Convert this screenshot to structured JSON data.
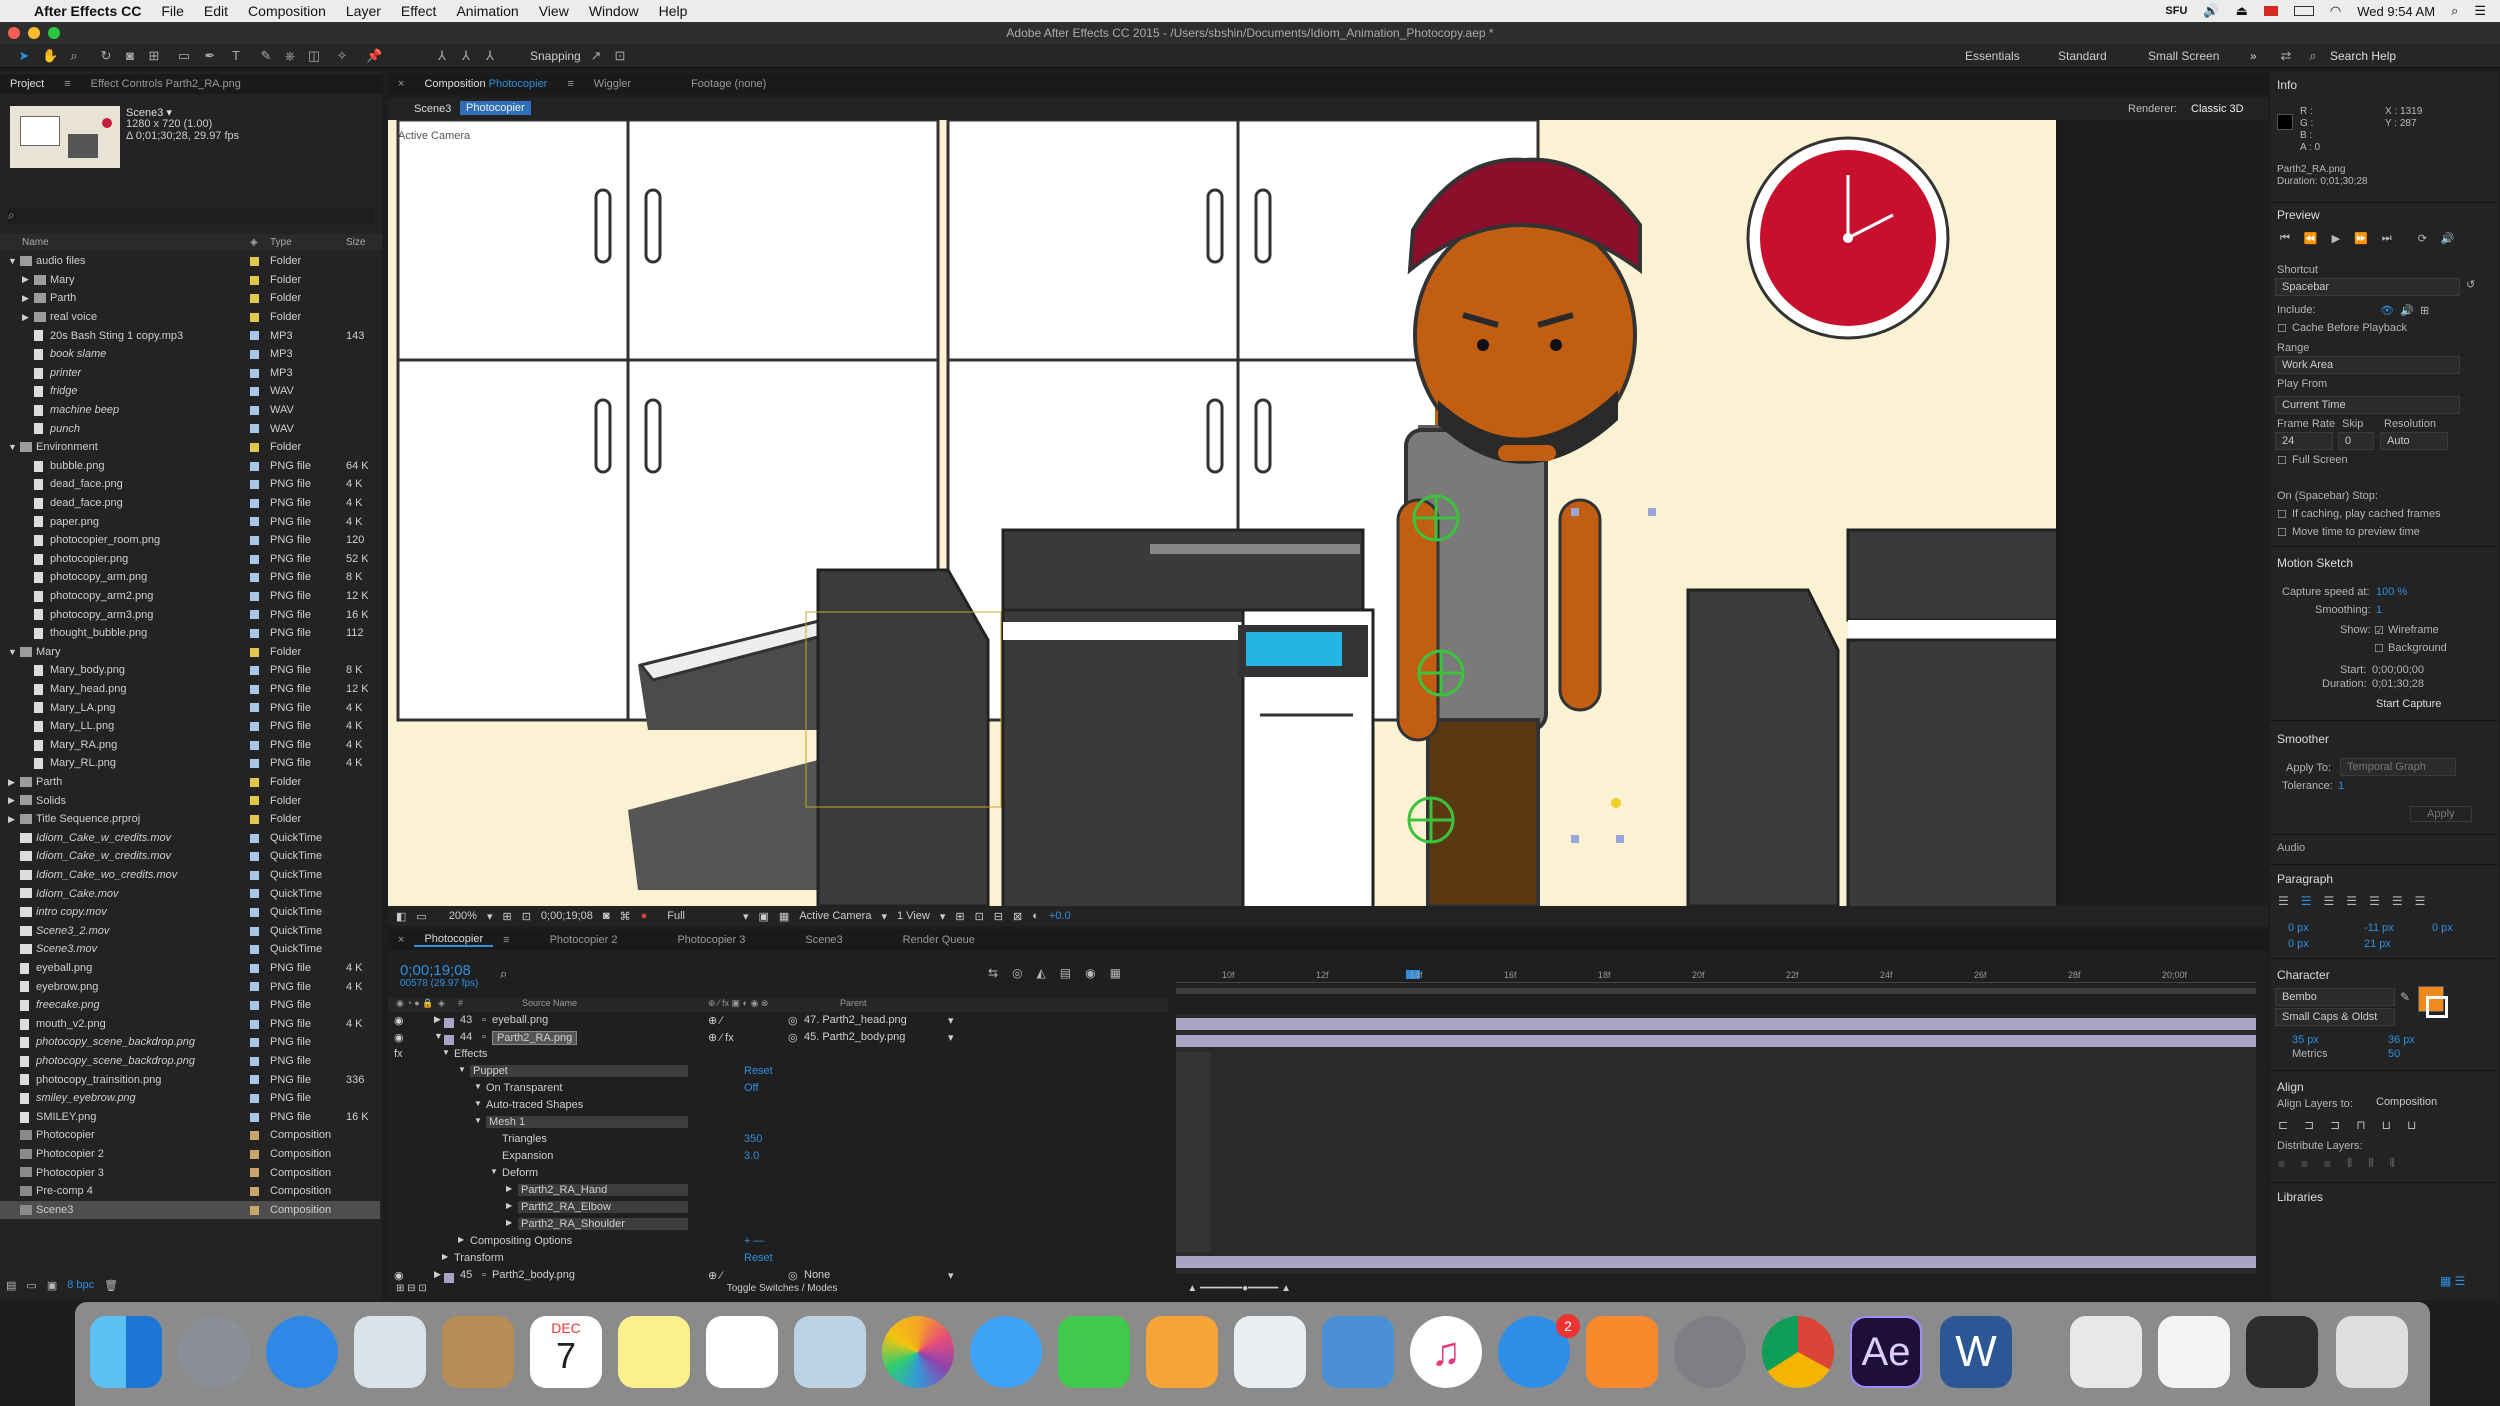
{
  "menubar": {
    "app_name": "After Effects CC",
    "items": [
      "File",
      "Edit",
      "Composition",
      "Layer",
      "Effect",
      "Animation",
      "View",
      "Window",
      "Help"
    ],
    "status": {
      "user": "SFU",
      "datetime": "Wed 9:54 AM"
    }
  },
  "window": {
    "title": "Adobe After Effects CC 2015 - /Users/sbshin/Documents/Idiom_Animation_Photocopy.aep *"
  },
  "toolbar": {
    "snapping_label": "Snapping",
    "workspaces": [
      "Essentials",
      "Standard",
      "Small Screen"
    ],
    "search_placeholder": "Search Help"
  },
  "project_panel": {
    "tab_project": "Project",
    "tab_effect_controls": "Effect Controls Parth2_RA.png",
    "selected_name": "Scene3 ▾",
    "selected_info": [
      "1280 x 720 (1.00)",
      "Δ 0;01;30;28, 29.97 fps"
    ],
    "columns": {
      "name": "Name",
      "type": "Type",
      "size": "Size"
    },
    "footer_bpc": "8 bpc",
    "items": [
      {
        "indent": 0,
        "kind": "folder",
        "open": true,
        "name": "audio files",
        "type": "Folder",
        "size": "",
        "color": "#e3c74c"
      },
      {
        "indent": 1,
        "kind": "folder",
        "name": "Mary",
        "type": "Folder",
        "size": "",
        "color": "#e3c74c"
      },
      {
        "indent": 1,
        "kind": "folder",
        "name": "Parth",
        "type": "Folder",
        "size": "",
        "color": "#e3c74c"
      },
      {
        "indent": 1,
        "kind": "folder",
        "name": "real voice",
        "type": "Folder",
        "size": "",
        "color": "#e3c74c"
      },
      {
        "indent": 1,
        "kind": "file",
        "name": "20s Bash Sting 1 copy.mp3",
        "type": "MP3",
        "size": "143",
        "color": "#a7c8e8"
      },
      {
        "indent": 1,
        "kind": "file",
        "name": "book slame",
        "italic": true,
        "type": "MP3",
        "size": "",
        "color": "#a7c8e8"
      },
      {
        "indent": 1,
        "kind": "file",
        "name": "printer",
        "italic": true,
        "type": "MP3",
        "size": "",
        "color": "#a7c8e8"
      },
      {
        "indent": 1,
        "kind": "file",
        "name": "fridge",
        "italic": true,
        "type": "WAV",
        "size": "",
        "color": "#a7c8e8"
      },
      {
        "indent": 1,
        "kind": "file",
        "name": "machine beep",
        "italic": true,
        "type": "WAV",
        "size": "",
        "color": "#a7c8e8"
      },
      {
        "indent": 1,
        "kind": "file",
        "name": "punch",
        "italic": true,
        "type": "WAV",
        "size": "",
        "color": "#a7c8e8"
      },
      {
        "indent": 0,
        "kind": "folder",
        "open": true,
        "name": "Environment",
        "type": "Folder",
        "size": "",
        "color": "#e3c74c"
      },
      {
        "indent": 1,
        "kind": "file",
        "name": "bubble.png",
        "type": "PNG file",
        "size": "64 K",
        "color": "#a7c8e8"
      },
      {
        "indent": 1,
        "kind": "file",
        "name": "dead_face.png",
        "type": "PNG file",
        "size": "4 K",
        "color": "#a7c8e8"
      },
      {
        "indent": 1,
        "kind": "file",
        "name": "dead_face.png",
        "type": "PNG file",
        "size": "4 K",
        "color": "#a7c8e8"
      },
      {
        "indent": 1,
        "kind": "file",
        "name": "paper.png",
        "type": "PNG file",
        "size": "4 K",
        "color": "#a7c8e8"
      },
      {
        "indent": 1,
        "kind": "file",
        "name": "photocopier_room.png",
        "type": "PNG file",
        "size": "120",
        "color": "#a7c8e8"
      },
      {
        "indent": 1,
        "kind": "file",
        "name": "photocopier.png",
        "type": "PNG file",
        "size": "52 K",
        "color": "#a7c8e8"
      },
      {
        "indent": 1,
        "kind": "file",
        "name": "photocopy_arm.png",
        "type": "PNG file",
        "size": "8 K",
        "color": "#a7c8e8"
      },
      {
        "indent": 1,
        "kind": "file",
        "name": "photocopy_arm2.png",
        "type": "PNG file",
        "size": "12 K",
        "color": "#a7c8e8"
      },
      {
        "indent": 1,
        "kind": "file",
        "name": "photocopy_arm3.png",
        "type": "PNG file",
        "size": "16 K",
        "color": "#a7c8e8"
      },
      {
        "indent": 1,
        "kind": "file",
        "name": "thought_bubble.png",
        "type": "PNG file",
        "size": "112",
        "color": "#a7c8e8"
      },
      {
        "indent": 0,
        "kind": "folder",
        "open": true,
        "name": "Mary",
        "type": "Folder",
        "size": "",
        "color": "#e3c74c"
      },
      {
        "indent": 1,
        "kind": "file",
        "name": "Mary_body.png",
        "type": "PNG file",
        "size": "8 K",
        "color": "#a7c8e8"
      },
      {
        "indent": 1,
        "kind": "file",
        "name": "Mary_head.png",
        "type": "PNG file",
        "size": "12 K",
        "color": "#a7c8e8"
      },
      {
        "indent": 1,
        "kind": "file",
        "name": "Mary_LA.png",
        "type": "PNG file",
        "size": "4 K",
        "color": "#a7c8e8"
      },
      {
        "indent": 1,
        "kind": "file",
        "name": "Mary_LL.png",
        "type": "PNG file",
        "size": "4 K",
        "color": "#a7c8e8"
      },
      {
        "indent": 1,
        "kind": "file",
        "name": "Mary_RA.png",
        "type": "PNG file",
        "size": "4 K",
        "color": "#a7c8e8"
      },
      {
        "indent": 1,
        "kind": "file",
        "name": "Mary_RL.png",
        "type": "PNG file",
        "size": "4 K",
        "color": "#a7c8e8"
      },
      {
        "indent": 0,
        "kind": "folder",
        "name": "Parth",
        "type": "Folder",
        "size": "",
        "color": "#e3c74c"
      },
      {
        "indent": 0,
        "kind": "folder",
        "name": "Solids",
        "type": "Folder",
        "size": "",
        "color": "#e3c74c"
      },
      {
        "indent": 0,
        "kind": "folder",
        "name": "Title Sequence.prproj",
        "type": "Folder",
        "size": "",
        "color": "#e3c74c"
      },
      {
        "indent": 0,
        "kind": "movie",
        "name": "Idiom_Cake_w_credits.mov",
        "italic": true,
        "type": "QuickTime",
        "size": "",
        "color": "#a7c8e8"
      },
      {
        "indent": 0,
        "kind": "movie",
        "name": "Idiom_Cake_w_credits.mov",
        "italic": true,
        "type": "QuickTime",
        "size": "",
        "color": "#a7c8e8"
      },
      {
        "indent": 0,
        "kind": "movie",
        "name": "Idiom_Cake_wo_credits.mov",
        "italic": true,
        "type": "QuickTime",
        "size": "",
        "color": "#a7c8e8"
      },
      {
        "indent": 0,
        "kind": "movie",
        "name": "Idiom_Cake.mov",
        "italic": true,
        "type": "QuickTime",
        "size": "",
        "color": "#a7c8e8"
      },
      {
        "indent": 0,
        "kind": "movie",
        "name": "intro copy.mov",
        "italic": true,
        "type": "QuickTime",
        "size": "",
        "color": "#a7c8e8"
      },
      {
        "indent": 0,
        "kind": "movie",
        "name": "Scene3_2.mov",
        "italic": true,
        "type": "QuickTime",
        "size": "",
        "color": "#a7c8e8"
      },
      {
        "indent": 0,
        "kind": "movie",
        "name": "Scene3.mov",
        "italic": true,
        "type": "QuickTime",
        "size": "",
        "color": "#a7c8e8"
      },
      {
        "indent": 0,
        "kind": "file",
        "name": "eyeball.png",
        "type": "PNG file",
        "size": "4 K",
        "color": "#a7c8e8"
      },
      {
        "indent": 0,
        "kind": "file",
        "name": "eyebrow.png",
        "type": "PNG file",
        "size": "4 K",
        "color": "#a7c8e8"
      },
      {
        "indent": 0,
        "kind": "file",
        "name": "freecake.png",
        "italic": true,
        "type": "PNG file",
        "size": "",
        "color": "#a7c8e8"
      },
      {
        "indent": 0,
        "kind": "file",
        "name": "mouth_v2.png",
        "type": "PNG file",
        "size": "4 K",
        "color": "#a7c8e8"
      },
      {
        "indent": 0,
        "kind": "file",
        "name": "photocopy_scene_backdrop.png",
        "italic": true,
        "type": "PNG file",
        "size": "",
        "color": "#a7c8e8"
      },
      {
        "indent": 0,
        "kind": "file",
        "name": "photocopy_scene_backdrop.png",
        "italic": true,
        "type": "PNG file",
        "size": "",
        "color": "#a7c8e8"
      },
      {
        "indent": 0,
        "kind": "file",
        "name": "photocopy_trainsition.png",
        "type": "PNG file",
        "size": "336",
        "color": "#a7c8e8"
      },
      {
        "indent": 0,
        "kind": "file",
        "name": "smiley_eyebrow.png",
        "italic": true,
        "type": "PNG file",
        "size": "",
        "color": "#a7c8e8"
      },
      {
        "indent": 0,
        "kind": "file",
        "name": "SMILEY.png",
        "type": "PNG file",
        "size": "16 K",
        "color": "#a7c8e8"
      },
      {
        "indent": 0,
        "kind": "comp",
        "name": "Photocopier",
        "type": "Composition",
        "size": "",
        "color": "#c9a46b"
      },
      {
        "indent": 0,
        "kind": "comp",
        "name": "Photocopier 2",
        "type": "Composition",
        "size": "",
        "color": "#c9a46b"
      },
      {
        "indent": 0,
        "kind": "comp",
        "name": "Photocopier 3",
        "type": "Composition",
        "size": "",
        "color": "#c9a46b"
      },
      {
        "indent": 0,
        "kind": "comp",
        "name": "Pre-comp 4",
        "type": "Composition",
        "size": "",
        "color": "#c9a46b"
      },
      {
        "indent": 0,
        "kind": "comp",
        "name": "Scene3",
        "type": "Composition",
        "size": "",
        "color": "#c9a46b",
        "selected": true
      }
    ]
  },
  "comp_panel": {
    "tab_prefix": "Composition",
    "tab_name": "Photocopier",
    "other_tabs": [
      "Wiggler",
      "Footage (none)"
    ],
    "breadcrumbs": [
      "Scene3",
      "Photocopier"
    ],
    "renderer_label": "Renderer:",
    "renderer_value": "Classic 3D",
    "camera_label": "Active Camera",
    "footer": {
      "zoom": "200%",
      "timecode": "0;00;19;08",
      "resolution": "Full",
      "view": "Active Camera",
      "views": "1 View",
      "exposure": "+0.0"
    }
  },
  "timeline": {
    "tabs": [
      "Photocopier",
      "Photocopier 2",
      "Photocopier 3",
      "Scene3",
      "Render Queue"
    ],
    "current_time": "0;00;19;08",
    "frame_info": "00578 (29.97 fps)",
    "columns": {
      "num": "#",
      "source": "Source Name",
      "parent": "Parent"
    },
    "ruler": [
      "10f",
      "12f",
      "14f",
      "16f",
      "18f",
      "20f",
      "22f",
      "24f",
      "26f",
      "28f",
      "20;00f"
    ],
    "layers": [
      {
        "num": "43",
        "name": "eyeball.png",
        "parent": "47. Parth2_head.png"
      },
      {
        "num": "44",
        "name": "Parth2_RA.png",
        "parent": "45. Parth2_body.png",
        "selected": true
      }
    ],
    "props": [
      {
        "indent": 1,
        "label": "Effects",
        "value": ""
      },
      {
        "indent": 2,
        "label": "Puppet",
        "value": "Reset",
        "highlight": true
      },
      {
        "indent": 3,
        "label": "On Transparent",
        "value": "Off"
      },
      {
        "indent": 3,
        "label": "Auto-traced Shapes",
        "value": ""
      },
      {
        "indent": 3,
        "label": "Mesh 1",
        "value": "",
        "highlight": true
      },
      {
        "indent": 4,
        "label": "Triangles",
        "value": "350"
      },
      {
        "indent": 4,
        "label": "Expansion",
        "value": "3.0"
      },
      {
        "indent": 4,
        "label": "Deform",
        "value": ""
      },
      {
        "indent": 5,
        "label": "Parth2_RA_Hand",
        "value": "",
        "highlight": true
      },
      {
        "indent": 5,
        "label": "Parth2_RA_Elbow",
        "value": "",
        "highlight": true
      },
      {
        "indent": 5,
        "label": "Parth2_RA_Shoulder",
        "value": "",
        "highlight": true
      },
      {
        "indent": 2,
        "label": "Compositing Options",
        "value": "+ —"
      },
      {
        "indent": 1,
        "label": "Transform",
        "value": "Reset"
      }
    ],
    "last_layer": {
      "num": "45",
      "name": "Parth2_body.png",
      "parent": "None"
    },
    "toggle_label": "Toggle Switches / Modes"
  },
  "info_panel": {
    "title": "Info",
    "rgba": [
      "R :",
      "G :",
      "B :",
      "A : 0"
    ],
    "xy": [
      "X : 1319",
      "Y : 287"
    ],
    "file": "Parth2_RA.png",
    "duration": "Duration: 0;01;30;28"
  },
  "preview_panel": {
    "title": "Preview",
    "shortcut_label": "Shortcut",
    "shortcut": "Spacebar",
    "include_label": "Include:",
    "cache_label": "Cache Before Playback",
    "range_label": "Range",
    "range": "Work Area",
    "play_from_label": "Play From",
    "play_from": "Current Time",
    "frame_rate_label": "Frame Rate",
    "skip_label": "Skip",
    "resolution_label": "Resolution",
    "frame_rate": "24",
    "skip": "0",
    "resolution": "Auto",
    "full_screen": "Full Screen",
    "stop_label": "On (Spacebar) Stop:",
    "stop_opt1": "If caching, play cached frames",
    "stop_opt2": "Move time to preview time"
  },
  "motion_sketch": {
    "title": "Motion Sketch",
    "capture_label": "Capture speed at:",
    "capture_value": "100 %",
    "smoothing_label": "Smoothing:",
    "smoothing_value": "1",
    "show_label": "Show:",
    "wireframe": "Wireframe",
    "background": "Background",
    "start_label": "Start:",
    "start": "0;00;00;00",
    "duration_label": "Duration:",
    "duration": "0;01;30;28",
    "button": "Start Capture"
  },
  "smoother": {
    "title": "Smoother",
    "apply_to_label": "Apply To:",
    "apply_to": "Temporal Graph",
    "tolerance_label": "Tolerance:",
    "tolerance": "1",
    "apply": "Apply"
  },
  "audio_title": "Audio",
  "paragraph": {
    "title": "Paragraph",
    "v1": "0 px",
    "v2": "-11 px",
    "v3": "0 px",
    "v4": "0 px",
    "v5": "21 px"
  },
  "character": {
    "title": "Character",
    "font": "Bembo",
    "style": "Small Caps & Oldst",
    "size": "35 px",
    "leading": "36 px",
    "kerning": "Metrics",
    "tracking": "50",
    "fill_color": "#f08a1e"
  },
  "align": {
    "title": "Align",
    "layers_to_label": "Align Layers to:",
    "layers_to": "Composition",
    "distribute_label": "Distribute Layers:"
  },
  "libraries_title": "Libraries",
  "dock": {
    "calendar_month": "DEC",
    "calendar_day": "7",
    "appstore_badge": "2",
    "ae_label": "Ae"
  }
}
